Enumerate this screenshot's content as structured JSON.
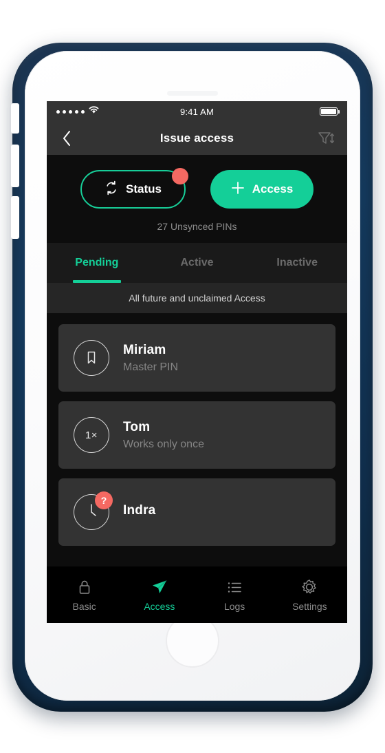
{
  "status_bar": {
    "signal_dots": 5,
    "wifi_icon": "wifi-icon",
    "time": "9:41 AM",
    "battery_icon": "battery-full-icon"
  },
  "nav": {
    "back_icon": "chevron-left-icon",
    "title": "Issue access",
    "filter_icon": "filter-sort-icon"
  },
  "actions": {
    "status_button": {
      "label": "Status",
      "icon": "sync-icon",
      "badge": true,
      "badge_color": "#f56962",
      "border_color": "#17ce98"
    },
    "access_button": {
      "label": "Access",
      "icon": "plus-icon",
      "background": "#14cf98"
    },
    "unsynced_text": "27 Unsynced PINs"
  },
  "tabs": [
    {
      "label": "Pending",
      "active": true
    },
    {
      "label": "Active",
      "active": false
    },
    {
      "label": "Inactive",
      "active": false
    }
  ],
  "subtitle": "All future and unclaimed Access",
  "list": [
    {
      "icon": "bookmark-icon",
      "name": "Miriam",
      "sub": "Master PIN",
      "badge": null
    },
    {
      "icon": "once-icon",
      "icon_label": "1×",
      "name": "Tom",
      "sub": "Works only once",
      "badge": null
    },
    {
      "icon": "clock-icon",
      "name": "Indra",
      "sub": "",
      "badge": "?"
    }
  ],
  "tabbar": [
    {
      "label": "Basic",
      "icon": "lock-icon",
      "active": false
    },
    {
      "label": "Access",
      "icon": "paper-plane-icon",
      "active": true
    },
    {
      "label": "Logs",
      "icon": "list-icon",
      "active": false
    },
    {
      "label": "Settings",
      "icon": "gear-icon",
      "active": false
    }
  ],
  "theme": {
    "accent": "#14cf98",
    "alert": "#f56962",
    "screen_bg": "#0d0d0d",
    "card_bg": "#333333",
    "chrome_bg": "#333333",
    "case_color": "#14395c"
  }
}
